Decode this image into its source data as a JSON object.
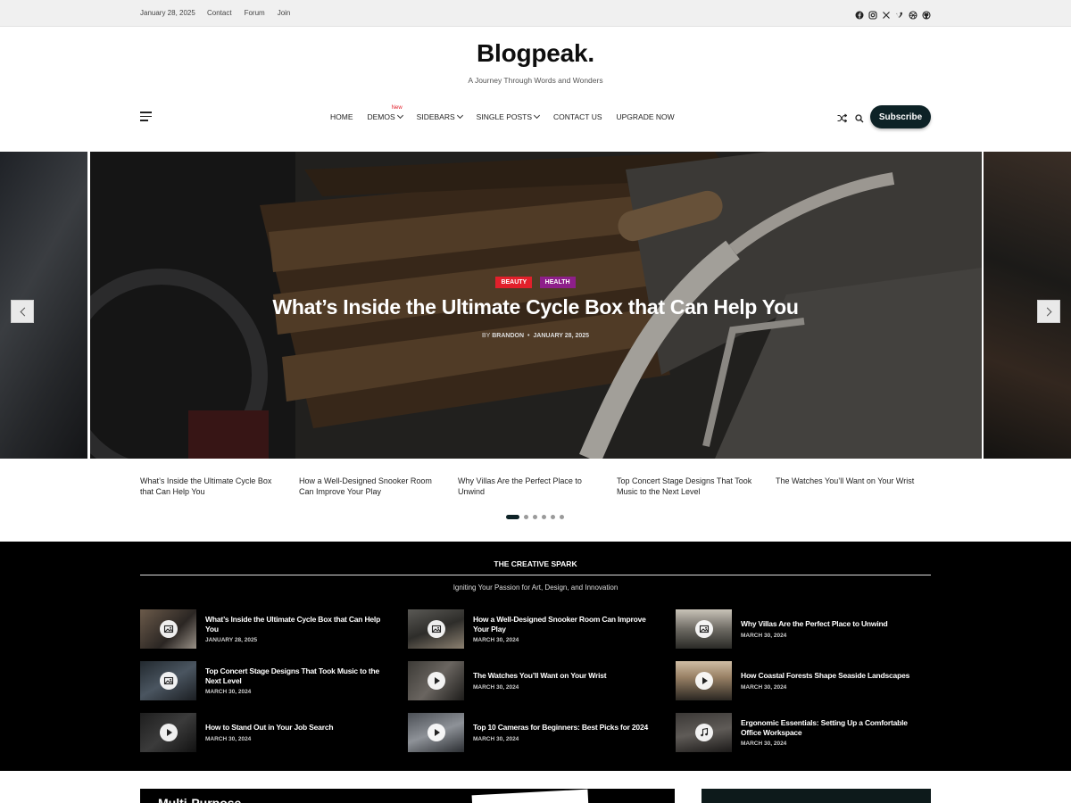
{
  "topbar": {
    "date": "January 28, 2025",
    "links": [
      "Contact",
      "Forum",
      "Join"
    ],
    "social_icons": [
      "facebook-icon",
      "instagram-icon",
      "x-icon",
      "vimeo-icon",
      "dribbble-icon",
      "github-icon"
    ]
  },
  "header": {
    "brand": "Blogpeak.",
    "tagline": "A Journey Through Words and Wonders",
    "nav": [
      {
        "label": "HOME",
        "dropdown": false
      },
      {
        "label": "DEMOS",
        "dropdown": true,
        "badge": "New"
      },
      {
        "label": "SIDEBARS",
        "dropdown": true
      },
      {
        "label": "SINGLE POSTS",
        "dropdown": true
      },
      {
        "label": "CONTACT US",
        "dropdown": false
      },
      {
        "label": "UPGRADE NOW",
        "dropdown": false
      }
    ],
    "subscribe_label": "Subscribe"
  },
  "hero": {
    "categories": [
      {
        "label": "BEAUTY",
        "color": "#e2202b"
      },
      {
        "label": "HEALTH",
        "color": "#8e1f8a"
      }
    ],
    "title": "What’s Inside the Ultimate Cycle Box that Can Help You",
    "by_label": "BY",
    "author": "BRANDON",
    "date": "JANUARY 28, 2025"
  },
  "slider": {
    "titles": [
      "What’s Inside the Ultimate Cycle Box that Can Help You",
      "How a Well-Designed Snooker Room Can Improve Your Play",
      "Why Villas Are the Perfect Place to Unwind",
      "Top Concert Stage Designs That Took Music to the Next Level",
      "The Watches You’ll Want on Your Wrist"
    ],
    "dot_count": 6,
    "active_dot": 0
  },
  "section": {
    "title": "THE CREATIVE SPARK",
    "subtitle": "Igniting Your Passion for Art, Design, and Innovation",
    "items": [
      {
        "title": "What’s Inside the Ultimate Cycle Box that Can Help You",
        "date": "JANUARY 28, 2025",
        "icon": "gallery-icon"
      },
      {
        "title": "How a Well-Designed Snooker Room Can Improve Your Play",
        "date": "MARCH 30, 2024",
        "icon": "gallery-icon"
      },
      {
        "title": "Why Villas Are the Perfect Place to Unwind",
        "date": "MARCH 30, 2024",
        "icon": "gallery-icon"
      },
      {
        "title": "Top Concert Stage Designs That Took Music to the Next Level",
        "date": "MARCH 30, 2024",
        "icon": "gallery-icon"
      },
      {
        "title": "The Watches You’ll Want on Your Wrist",
        "date": "MARCH 30, 2024",
        "icon": "play-icon"
      },
      {
        "title": "How Coastal Forests Shape Seaside Landscapes",
        "date": "MARCH 30, 2024",
        "icon": "play-icon"
      },
      {
        "title": "How to Stand Out in Your Job Search",
        "date": "MARCH 30, 2024",
        "icon": "play-icon"
      },
      {
        "title": "Top 10 Cameras for Beginners: Best Picks for 2024",
        "date": "MARCH 30, 2024",
        "icon": "play-icon"
      },
      {
        "title": "Ergonomic Essentials: Setting Up a Comfortable Office Workspace",
        "date": "MARCH 30, 2024",
        "icon": "music-icon"
      }
    ]
  },
  "bottom": {
    "left_heading": "Multi-Purpose"
  }
}
